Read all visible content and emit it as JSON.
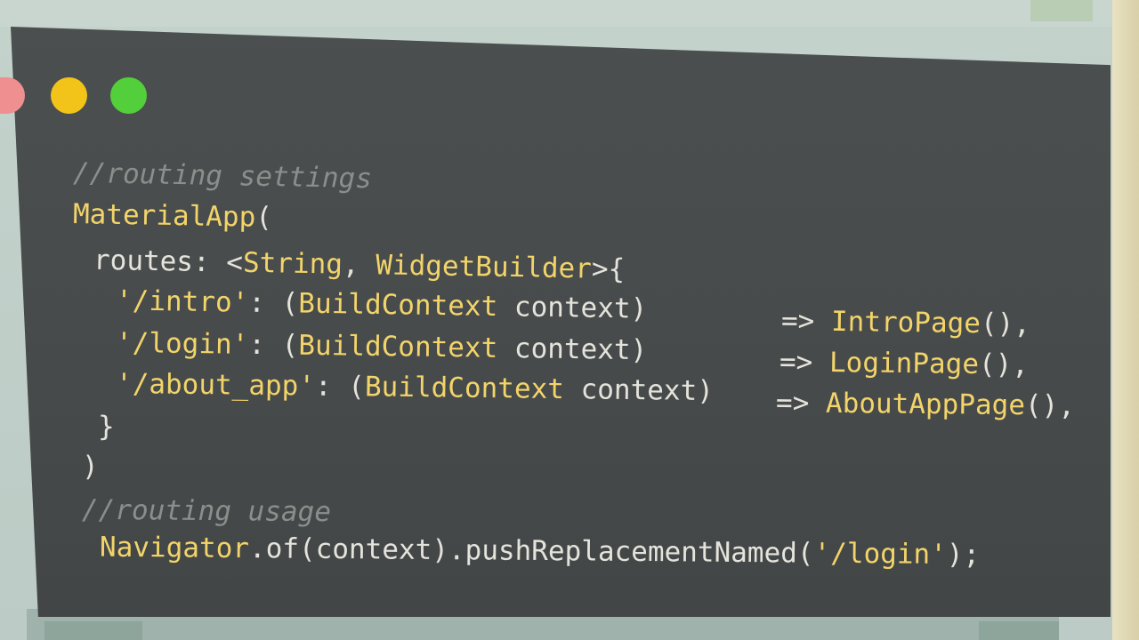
{
  "window": {
    "controls": [
      "close",
      "minimize",
      "maximize"
    ],
    "colors": {
      "close": "#ef8f8f",
      "minimize": "#f2c419",
      "maximize": "#52cf3a",
      "background": "#474b4b",
      "keyword": "#f3d46a",
      "comment": "#8a8f8c",
      "text": "#e4e3dc"
    }
  },
  "code": {
    "comment_settings": "//routing settings",
    "material_app": "MaterialApp",
    "open_paren": "(",
    "routes_key": "routes: <",
    "string_type": "String",
    "comma_space": ", ",
    "widget_builder": "WidgetBuilder",
    "routes_open": ">{",
    "routes": [
      {
        "path": "'/intro'",
        "colon": ": (",
        "type": "BuildContext",
        "param": " context)",
        "arrow": "=> ",
        "page": "IntroPage",
        "tail": "(),"
      },
      {
        "path": "'/login'",
        "colon": ": (",
        "type": "BuildContext",
        "param": " context)",
        "arrow": "=> ",
        "page": "LoginPage",
        "tail": "(),"
      },
      {
        "path": "'/about_app'",
        "colon": ": (",
        "type": "BuildContext",
        "param": " context)",
        "arrow": "=> ",
        "page": "AboutAppPage",
        "tail": "(),"
      }
    ],
    "close_brace": "}",
    "close_paren": ")",
    "comment_usage": "//routing usage",
    "navigator": "Navigator",
    "nav_call": ".of(context).pushReplacementNamed(",
    "nav_arg": "'/login'",
    "nav_end": ");"
  }
}
